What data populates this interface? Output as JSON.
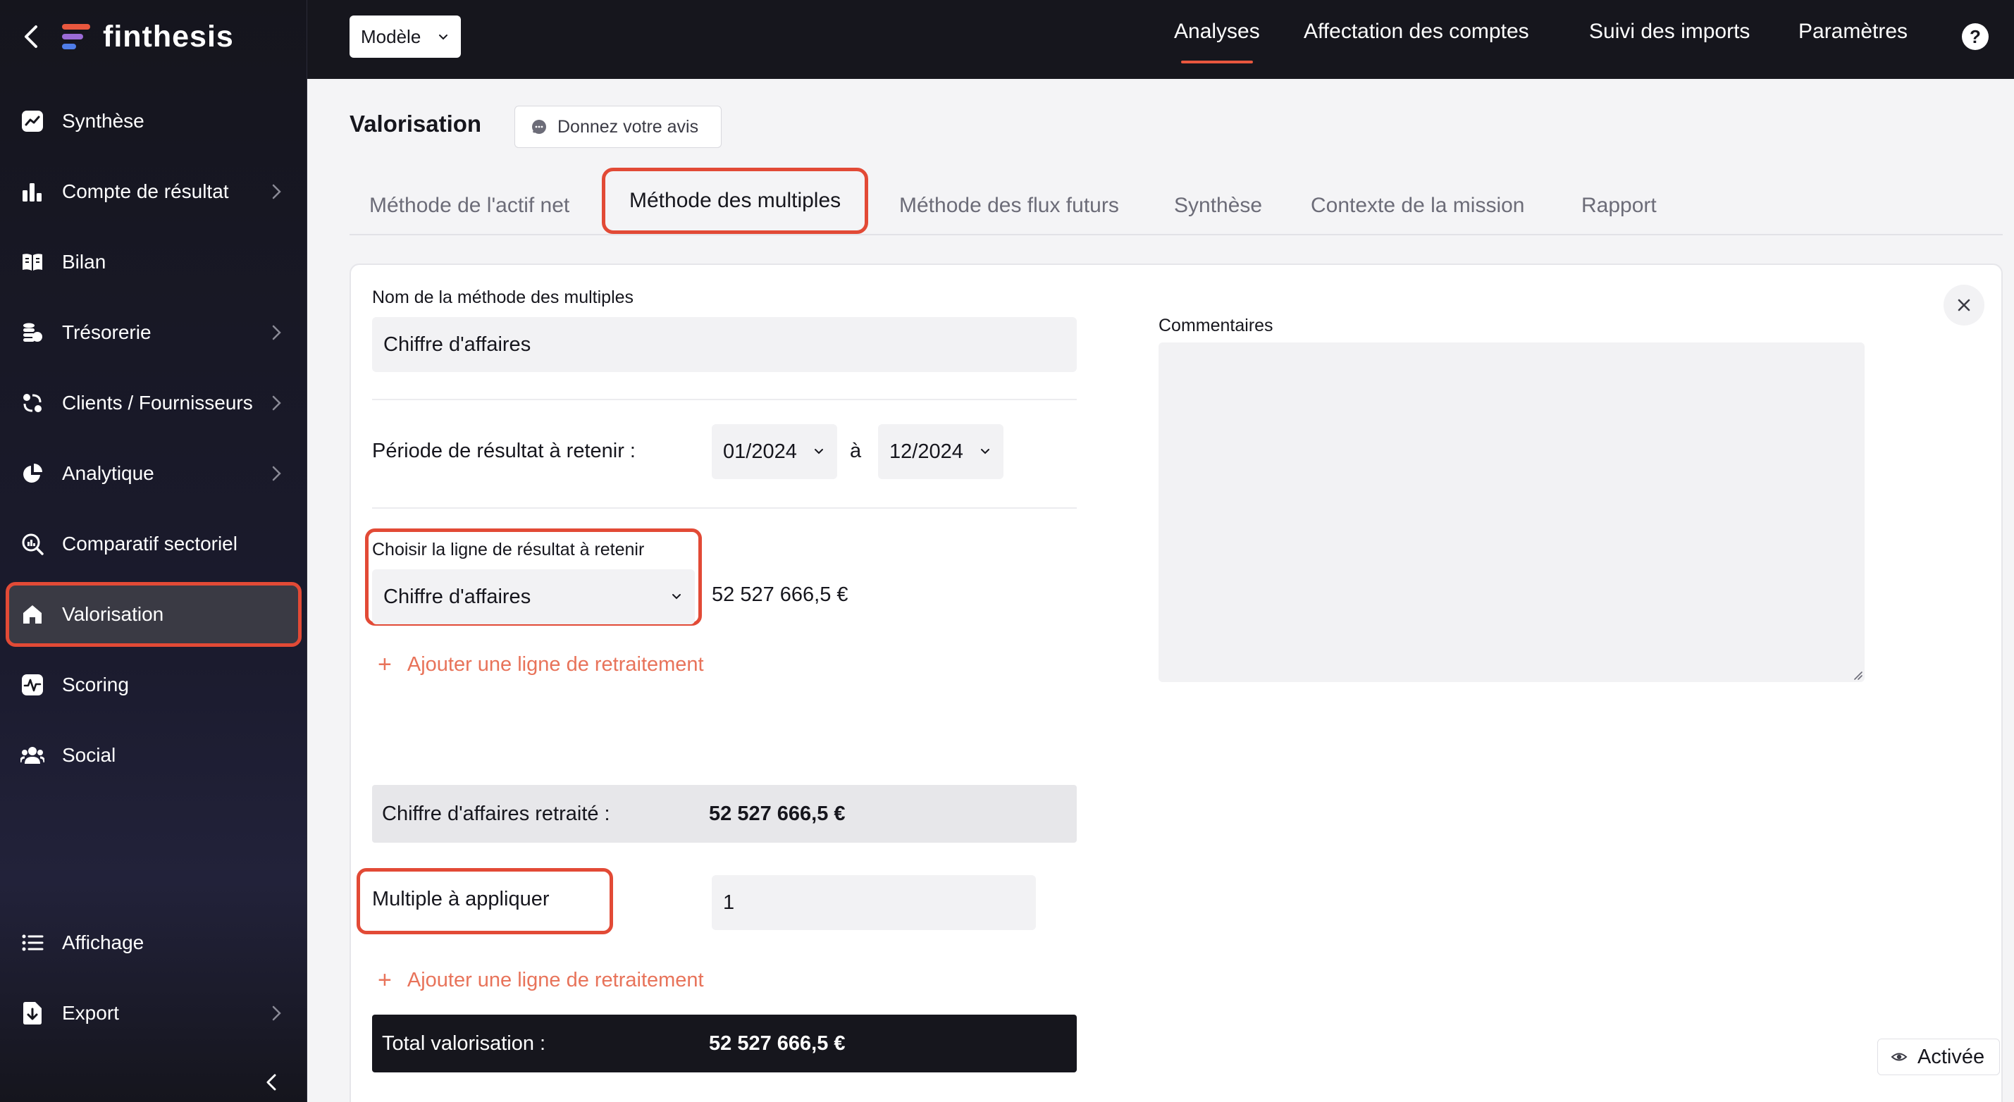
{
  "brand": {
    "name": "finthesis"
  },
  "sidebar": {
    "items": [
      {
        "label": "Synthèse",
        "icon": "trend-chart-icon",
        "has_submenu": false,
        "active": false
      },
      {
        "label": "Compte de résultat",
        "icon": "bar-chart-icon",
        "has_submenu": true,
        "active": false
      },
      {
        "label": "Bilan",
        "icon": "book-icon",
        "has_submenu": false,
        "active": false
      },
      {
        "label": "Trésorerie",
        "icon": "coins-icon",
        "has_submenu": true,
        "active": false
      },
      {
        "label": "Clients / Fournisseurs",
        "icon": "exchange-icon",
        "has_submenu": true,
        "active": false
      },
      {
        "label": "Analytique",
        "icon": "pie-chart-icon",
        "has_submenu": true,
        "active": false
      },
      {
        "label": "Comparatif sectoriel",
        "icon": "search-chart-icon",
        "has_submenu": false,
        "active": false
      },
      {
        "label": "Valorisation",
        "icon": "home-icon",
        "has_submenu": false,
        "active": true
      },
      {
        "label": "Scoring",
        "icon": "pulse-icon",
        "has_submenu": false,
        "active": false
      },
      {
        "label": "Social",
        "icon": "users-icon",
        "has_submenu": false,
        "active": false
      },
      {
        "label": "Affichage",
        "icon": "list-icon",
        "has_submenu": false,
        "active": false
      },
      {
        "label": "Export",
        "icon": "export-icon",
        "has_submenu": true,
        "active": false
      }
    ]
  },
  "topbar": {
    "model_label": "Modèle",
    "nav": [
      {
        "label": "Analyses",
        "active": true
      },
      {
        "label": "Affectation des comptes",
        "active": false
      },
      {
        "label": "Suivi des imports",
        "active": false
      },
      {
        "label": "Paramètres",
        "active": false
      }
    ],
    "help_label": "?"
  },
  "page": {
    "title": "Valorisation",
    "feedback_label": "Donnez votre avis",
    "tabs": [
      {
        "label": "Méthode de l'actif net",
        "active": false
      },
      {
        "label": "Méthode des multiples",
        "active": true
      },
      {
        "label": "Méthode des flux futurs",
        "active": false
      },
      {
        "label": "Synthèse",
        "active": false
      },
      {
        "label": "Contexte de la mission",
        "active": false
      },
      {
        "label": "Rapport",
        "active": false
      }
    ]
  },
  "form": {
    "method_name_label": "Nom de la méthode des multiples",
    "method_name_value": "Chiffre d'affaires",
    "period_label": "Période de résultat à retenir :",
    "period_from": "01/2024",
    "period_sep": "à",
    "period_to": "12/2024",
    "line_label": "Choisir la ligne de résultat à retenir",
    "line_value": "Chiffre d'affaires",
    "line_amount": "52 527 666,5 €",
    "add_restatement": "Ajouter une ligne de retraitement",
    "restated_label": "Chiffre d'affaires retraité :",
    "restated_value": "52 527 666,5 €",
    "multiple_label": "Multiple à appliquer",
    "multiple_value": "1",
    "add_restatement_2": "Ajouter une ligne de retraitement",
    "total_label": "Total valorisation :",
    "total_value": "52 527 666,5 €",
    "comments_label": "Commentaires",
    "comments_value": "",
    "status_label": "Activée"
  },
  "colors": {
    "accent": "#e24a36",
    "link": "#e8735a",
    "sidebar_bg": "#16161d",
    "total_bg": "#16161d",
    "restated_bg": "#e7e7ea"
  }
}
